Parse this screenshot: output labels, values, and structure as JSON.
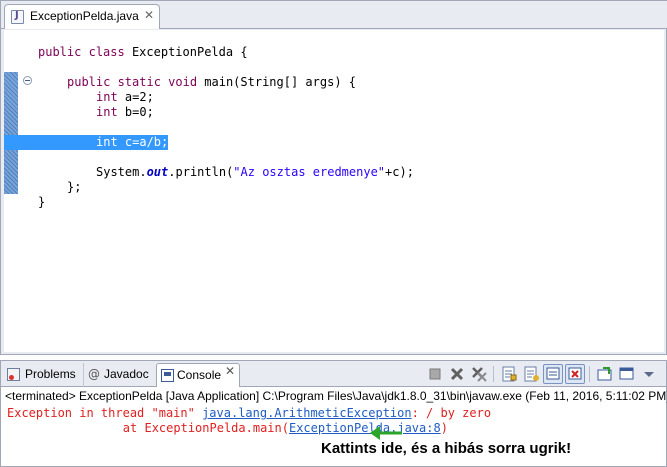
{
  "editor": {
    "tab_label": "ExceptionPelda.java",
    "tab_close": "✕",
    "code": {
      "line1": [
        "public",
        " ",
        "class",
        " ExceptionPelda {"
      ],
      "line2_kw": "public static void",
      "line2_rest": " main(String[] args) {",
      "line3_kw": "int",
      "line3_rest": " a=2;",
      "line4_kw": "int",
      "line4_rest": " b=0;",
      "line5_kw": "int",
      "line5_rest": " c=a/b;",
      "line6_a": "System.",
      "line6_field": "out",
      "line6_b": ".println(",
      "line6_str": "\"Az osztas eredmenye\"",
      "line6_c": "+c);",
      "line7": "};",
      "line8": "}"
    }
  },
  "panel": {
    "tabs": {
      "problems": "Problems",
      "javadoc": "Javadoc",
      "console": "Console",
      "console_close": "✕"
    },
    "console_header": "<terminated> ExceptionPelda [Java Application] C:\\Program Files\\Java\\jdk1.8.0_31\\bin\\javaw.exe (Feb 11, 2016, 5:11:02 PM)",
    "output": {
      "line1_pre": "Exception in thread \"main\" ",
      "line1_link": "java.lang.ArithmeticException",
      "line1_post": ": / by zero",
      "line2_pre": "\tat ExceptionPelda.main(",
      "line2_link": "ExceptionPelda.java:8",
      "line2_post": ")"
    }
  },
  "annotation": "Kattints ide, és a hibás sorra ugrik!",
  "icons": [
    "java-file-icon",
    "problems-icon",
    "javadoc-icon",
    "console-icon",
    "terminate-icon",
    "remove-launch-icon",
    "remove-all-icon",
    "scroll-lock-icon",
    "word-wrap-icon",
    "pin-console-icon",
    "display-selected-console-icon",
    "open-console-icon",
    "minimize-icon",
    "maximize-icon"
  ],
  "colors": {
    "keyword": "#7f0055",
    "string": "#2a00ff",
    "selection": "#3399ff",
    "error_text": "#e02020",
    "link": "#1f5cc4",
    "arrow": "#2aa52a"
  }
}
